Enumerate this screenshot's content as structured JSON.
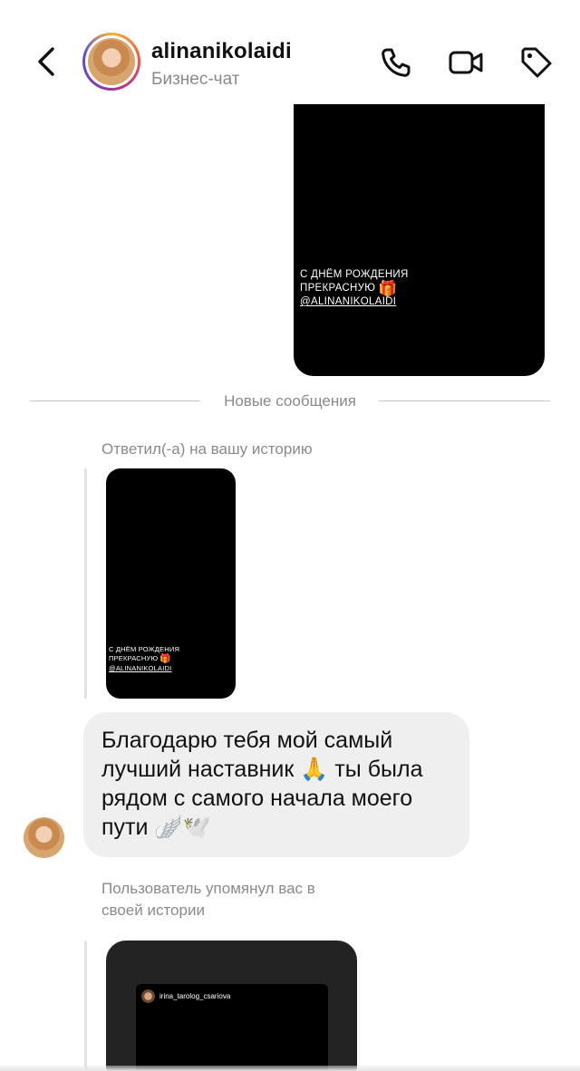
{
  "header": {
    "username": "alinanikolaidi",
    "subtitle": "Бизнес-чат",
    "icons": [
      "back-icon",
      "phone-icon",
      "video-icon",
      "tag-icon"
    ]
  },
  "top_story": {
    "caption_line1": "С ДНЁМ РОЖДЕНИЯ",
    "caption_line2": "ПРЕКРАСНУЮ",
    "caption_emoji": "🎁",
    "mention": "@ALINANIKOLAIDI"
  },
  "divider": {
    "label": "Новые сообщения"
  },
  "reply_block": {
    "label": "Ответил(-а) на вашу историю",
    "story": {
      "caption_line1": "С ДНЁМ РОЖДЕНИЯ",
      "caption_line2": "ПРЕКРАСНУЮ",
      "caption_emoji": "🎁",
      "mention": "@ALINANIKOLAIDI"
    }
  },
  "message": {
    "text": "Благодарю тебя мой самый\nлучший наставник 🙏 ты была\nрядом с самого начала моего\nпути 🪽🕊️"
  },
  "mention_block": {
    "label": "Пользователь упомянул вас в\nсвоей истории",
    "story_username": "irina_tarolog_csariova"
  },
  "colors": {
    "text_primary": "#111111",
    "text_secondary": "#8a8a8a",
    "bubble_bg": "#efefef",
    "story_bg": "#000000",
    "divider": "#c8c8c8"
  }
}
